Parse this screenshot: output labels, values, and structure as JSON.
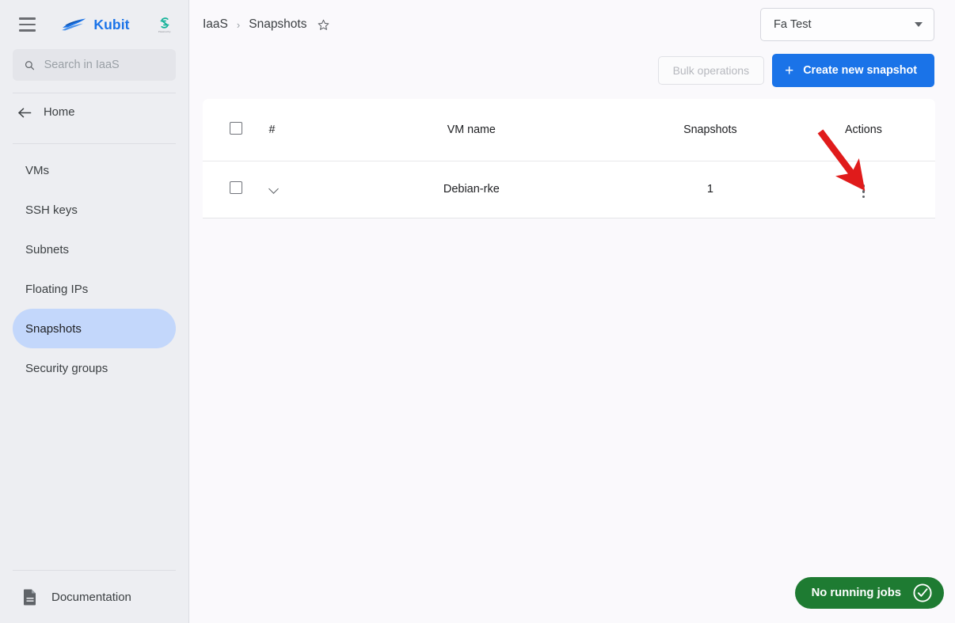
{
  "sidebar": {
    "menu_icon": "hamburger-icon",
    "brand": {
      "name": "Kubit",
      "logo": "kubit-wave-logo"
    },
    "partner": {
      "logo": "partner-s-logo",
      "subtitle": "Powered by"
    },
    "search": {
      "placeholder": "Search in IaaS",
      "value": "",
      "icon": "search-icon"
    },
    "home": {
      "label": "Home",
      "icon": "arrow-left-icon"
    },
    "items": [
      {
        "label": "VMs",
        "active": false
      },
      {
        "label": "SSH keys",
        "active": false
      },
      {
        "label": "Subnets",
        "active": false
      },
      {
        "label": "Floating IPs",
        "active": false
      },
      {
        "label": "Snapshots",
        "active": true
      },
      {
        "label": "Security groups",
        "active": false
      }
    ],
    "documentation": {
      "label": "Documentation",
      "icon": "document-icon"
    }
  },
  "header": {
    "breadcrumb": {
      "root": "IaaS",
      "separator": "›",
      "current": "Snapshots",
      "favorite_icon": "star-outline-icon"
    },
    "org_select": {
      "value": "Fa Test",
      "icon": "chevron-down-icon"
    }
  },
  "toolbar": {
    "bulk_label": "Bulk operations",
    "bulk_disabled": true,
    "create_label": "Create new snapshot",
    "create_icon": "plus-icon",
    "create_color": "#1a73e8"
  },
  "table": {
    "select_all_icon": "checkbox-unchecked-icon",
    "columns": [
      "#",
      "VM name",
      "Snapshots",
      "Actions"
    ],
    "rows": [
      {
        "checkbox_icon": "checkbox-unchecked-icon",
        "expand_icon": "chevron-down-icon",
        "vm_name": "Debian-rke",
        "snapshots": "1",
        "actions_icon": "kebab-menu-icon"
      }
    ]
  },
  "status": {
    "jobs_label": "No running jobs",
    "jobs_icon": "check-circle-icon",
    "jobs_color": "#1e7b32"
  },
  "annotation": {
    "arrow_color": "#e01b1b",
    "points_to": "row-actions-kebab-menu"
  }
}
